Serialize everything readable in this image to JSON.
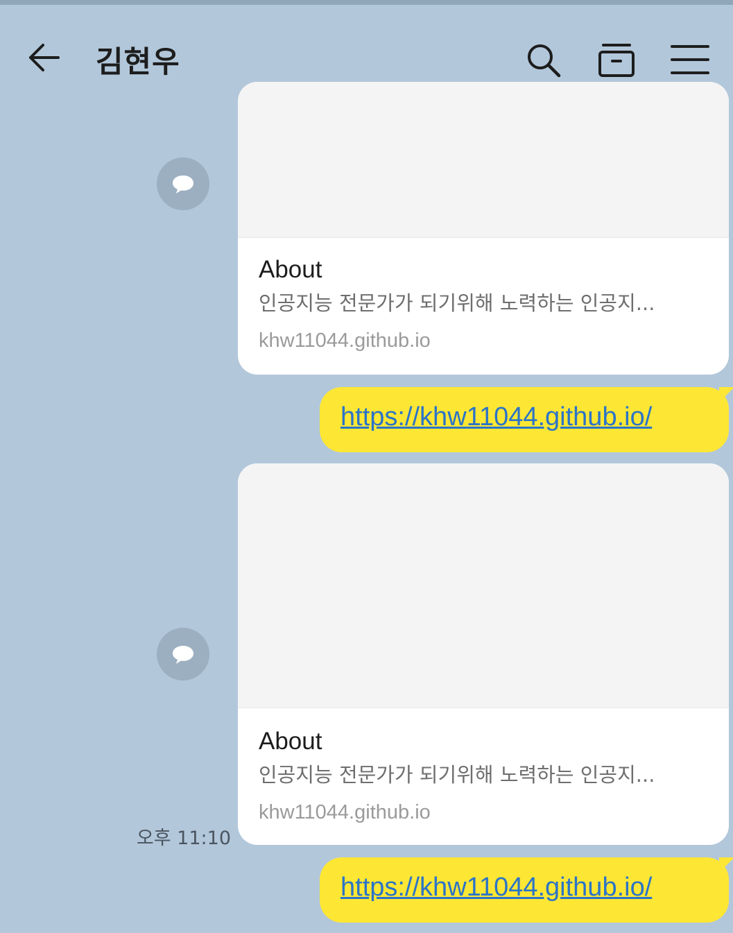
{
  "header": {
    "title": "김현우",
    "icons": [
      "back-arrow-icon",
      "search-icon",
      "drawer-icon",
      "menu-icon"
    ]
  },
  "messages": [
    {
      "type": "link-preview",
      "title": "About",
      "description": "인공지능 전문가가 되기위해 노력하는 인공지...",
      "domain": "khw11044.github.io"
    },
    {
      "type": "sent-link",
      "text": "https://khw11044.github.io/"
    },
    {
      "type": "link-preview",
      "title": "About",
      "description": "인공지능 전문가가 되기위해 노력하는 인공지...",
      "domain": "khw11044.github.io",
      "time": "오후 11:10"
    },
    {
      "type": "sent-link",
      "text": "https://khw11044.github.io/"
    }
  ],
  "colors": {
    "background": "#b2c7da",
    "sent_bubble": "#fee734",
    "link": "#2b74c7",
    "share_button": "#9cafc0"
  }
}
